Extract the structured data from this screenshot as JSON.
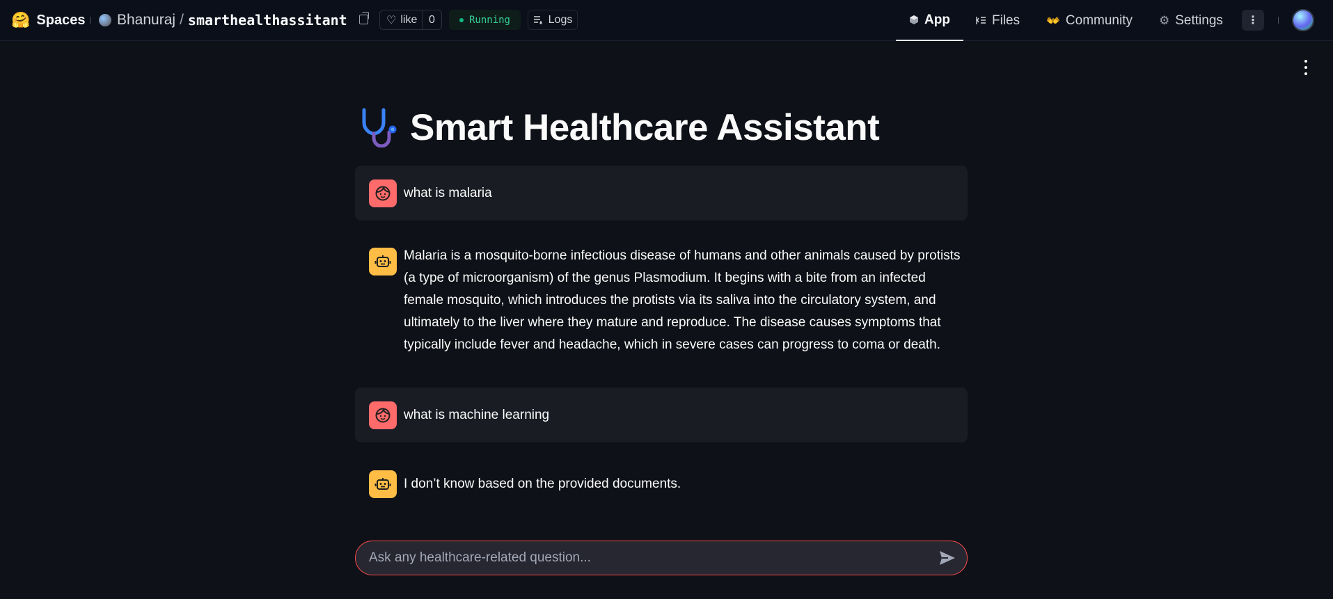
{
  "nav": {
    "brand": "Spaces",
    "owner": "Bhanuraj",
    "slash": "/",
    "repo": "smarthealthassitant",
    "like_label": "like",
    "like_count": "0",
    "status": "Running",
    "logs_label": "Logs",
    "tabs": [
      {
        "label": "App",
        "icon": "cube-icon"
      },
      {
        "label": "Files",
        "icon": "files-icon"
      },
      {
        "label": "Community",
        "icon": "community-icon"
      },
      {
        "label": "Settings",
        "icon": "gear-icon"
      }
    ]
  },
  "app": {
    "title": "Smart Healthcare Assistant",
    "title_icon": "stethoscope-icon",
    "messages": [
      {
        "role": "user",
        "text": "what is malaria"
      },
      {
        "role": "assistant",
        "text": "Malaria is a mosquito-borne infectious disease of humans and other animals caused by protists (a type of microorganism) of the genus Plasmodium. It begins with a bite from an infected female mosquito, which introduces the protists via its saliva into the circulatory system, and ultimately to the liver where they mature and reproduce. The disease causes symptoms that typically include fever and headache, which in severe cases can progress to coma or death."
      },
      {
        "role": "user",
        "text": "what is machine learning"
      },
      {
        "role": "assistant",
        "text": "I don’t know based on the provided documents."
      }
    ],
    "input_placeholder": "Ask any healthcare-related question..."
  },
  "colors": {
    "background": "#0e1117",
    "user_avatar": "#ff6b6b",
    "bot_avatar": "#ffbd45",
    "input_border": "#ff4b4b",
    "running": "#34d399"
  }
}
